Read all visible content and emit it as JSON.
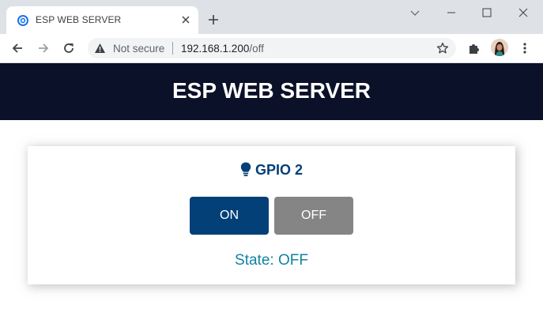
{
  "browser": {
    "tab_title": "ESP WEB SERVER",
    "not_secure_label": "Not secure",
    "url_host": "192.168.1.200",
    "url_path": "/off",
    "icons": {
      "favicon": "globe-icon",
      "tab_close": "close-icon",
      "new_tab": "plus-icon",
      "back": "arrow-left-icon",
      "forward": "arrow-right-icon",
      "reload": "reload-icon",
      "warning": "warning-triangle-icon",
      "bookmark": "star-icon",
      "extensions": "puzzle-icon",
      "menu": "kebab-menu-icon"
    }
  },
  "page": {
    "title": "ESP WEB SERVER",
    "header_color": "#0a1128",
    "card": {
      "title": "GPIO 2",
      "icon": "lightbulb-icon",
      "on_label": "ON",
      "off_label": "OFF",
      "state_text": "State: OFF",
      "on_color": "#034078",
      "off_color": "#858585",
      "state_color": "#1282a2"
    }
  }
}
